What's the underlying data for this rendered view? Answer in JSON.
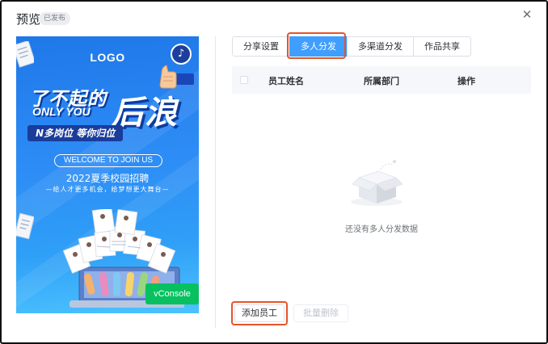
{
  "header": {
    "title": "预览",
    "status_badge": "已发布",
    "close_icon": "close-icon"
  },
  "poster": {
    "logo": "LOGO",
    "slogan_line1": "了不起的",
    "slogan_line2": "ONLY YOU",
    "slogan_big": "后浪",
    "slogan_tag": "N多岗位 等你归位",
    "welcome": "WELCOME TO JOIN US",
    "recruit_title": "2022夏季校园招聘",
    "recruit_sub": "—给人才更多机会，给梦想更大舞台—",
    "music_icon": "music-note-icon",
    "vconsole_label": "vConsole",
    "colors": {
      "bg_top": "#1f78e8",
      "bg_bottom": "#4cc3ff",
      "vconsole": "#07c160"
    }
  },
  "tabs": [
    {
      "label": "分享设置",
      "active": false
    },
    {
      "label": "多人分发",
      "active": true
    },
    {
      "label": "多渠道分发",
      "active": false
    },
    {
      "label": "作品共享",
      "active": false
    }
  ],
  "table": {
    "columns": [
      "员工姓名",
      "所属部门",
      "操作"
    ],
    "rows": []
  },
  "empty_state": {
    "icon": "empty-box-icon",
    "text": "还没有多人分发数据"
  },
  "actions": {
    "add_label": "添加员工",
    "batch_delete_label": "批量删除"
  },
  "colors": {
    "accent": "#409eff",
    "highlight": "#e55428"
  }
}
